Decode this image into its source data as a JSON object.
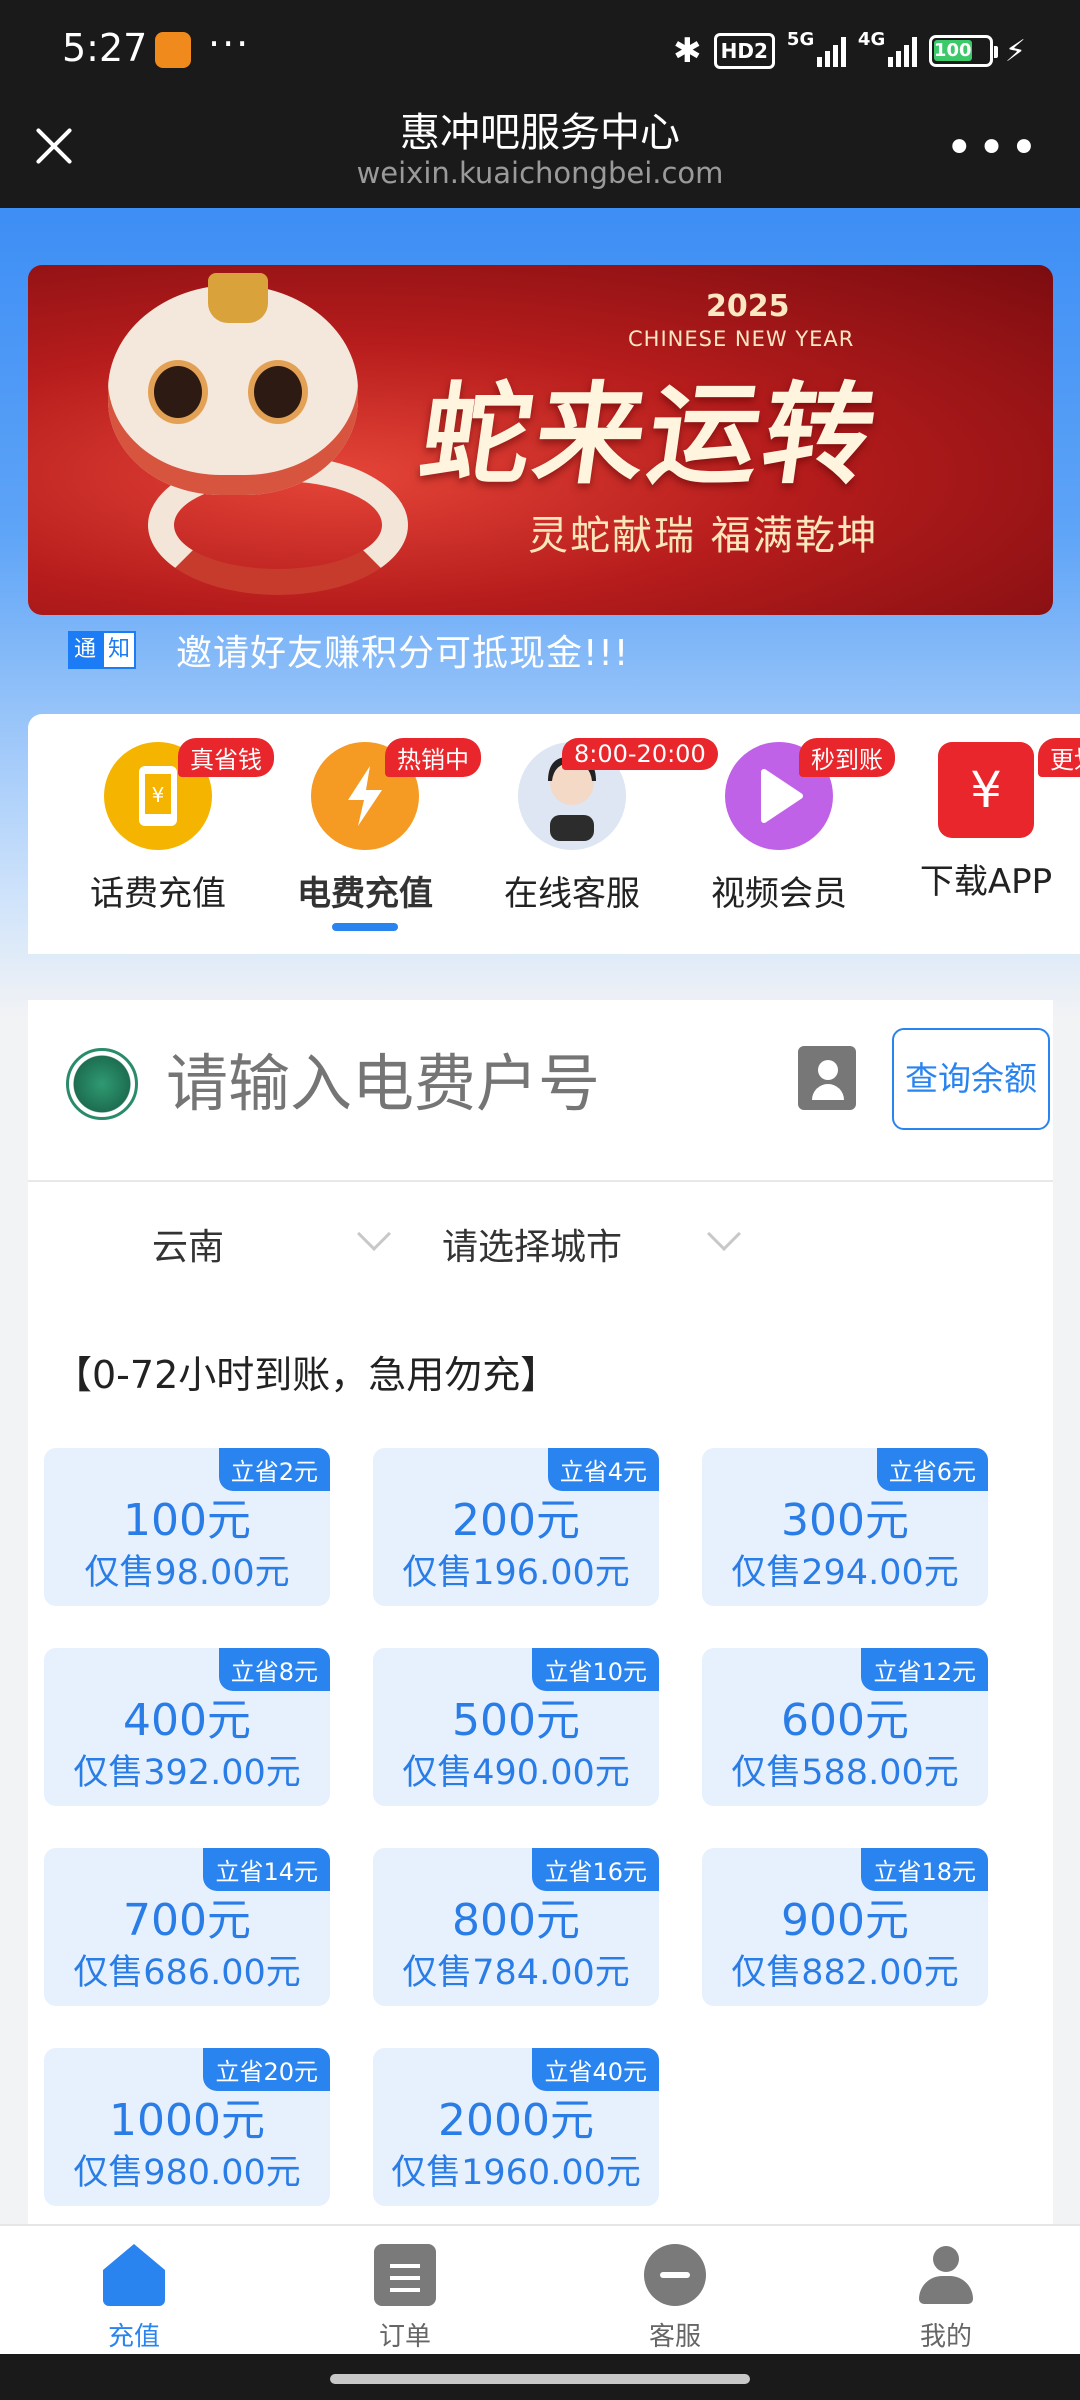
{
  "status_bar": {
    "time": "5:27",
    "dots": "···",
    "hd_label": "HD2",
    "signal_1": "5G",
    "signal_2": "4G",
    "battery": "100"
  },
  "title_bar": {
    "title": "惠冲吧服务中心",
    "url": "weixin.kuaichongbei.com",
    "more_label": "•••"
  },
  "banner": {
    "year": "2025",
    "subtitle_en": "CHINESE NEW YEAR",
    "headline": "蛇来运转",
    "slogan": "灵蛇献瑞 福满乾坤"
  },
  "notice": {
    "tag_1": "通",
    "tag_2": "知",
    "text": "邀请好友赚积分可抵现金!!!"
  },
  "categories": [
    {
      "label": "话费充值",
      "badge": "真省钱",
      "icon": "phone-icon",
      "color": "#f5b400"
    },
    {
      "label": "电费充值",
      "badge": "热销中",
      "icon": "lightning-icon",
      "color": "#f59a23",
      "active": true
    },
    {
      "label": "在线客服",
      "badge": "8:00-20:00",
      "icon": "agent-avatar-icon",
      "color": "#dde6f2"
    },
    {
      "label": "视频会员",
      "badge": "秒到账",
      "icon": "play-icon",
      "color": "#c062e8"
    },
    {
      "label": "下载APP",
      "badge": "更划算",
      "icon": "yen-icon",
      "color": "#e8262b"
    }
  ],
  "account": {
    "placeholder": "请输入电费户号",
    "query_label": "查询余额"
  },
  "region": {
    "province": "云南",
    "city_placeholder": "请选择城市"
  },
  "products": {
    "hint": "【0-72小时到账，急用勿充】",
    "items": [
      {
        "save": "立省2元",
        "face": "100元",
        "price": "仅售98.00元"
      },
      {
        "save": "立省4元",
        "face": "200元",
        "price": "仅售196.00元"
      },
      {
        "save": "立省6元",
        "face": "300元",
        "price": "仅售294.00元"
      },
      {
        "save": "立省8元",
        "face": "400元",
        "price": "仅售392.00元"
      },
      {
        "save": "立省10元",
        "face": "500元",
        "price": "仅售490.00元"
      },
      {
        "save": "立省12元",
        "face": "600元",
        "price": "仅售588.00元"
      },
      {
        "save": "立省14元",
        "face": "700元",
        "price": "仅售686.00元"
      },
      {
        "save": "立省16元",
        "face": "800元",
        "price": "仅售784.00元"
      },
      {
        "save": "立省18元",
        "face": "900元",
        "price": "仅售882.00元"
      },
      {
        "save": "立省20元",
        "face": "1000元",
        "price": "仅售980.00元"
      },
      {
        "save": "立省40元",
        "face": "2000元",
        "price": "仅售1960.00元"
      }
    ]
  },
  "tabbar": [
    {
      "label": "充值",
      "icon": "home-icon",
      "active": true
    },
    {
      "label": "订单",
      "icon": "order-icon"
    },
    {
      "label": "客服",
      "icon": "chat-icon"
    },
    {
      "label": "我的",
      "icon": "user-icon"
    }
  ],
  "colors": {
    "accent": "#2a84f0",
    "badge_red": "#e8262b",
    "card_bg": "#e7f1fd"
  }
}
